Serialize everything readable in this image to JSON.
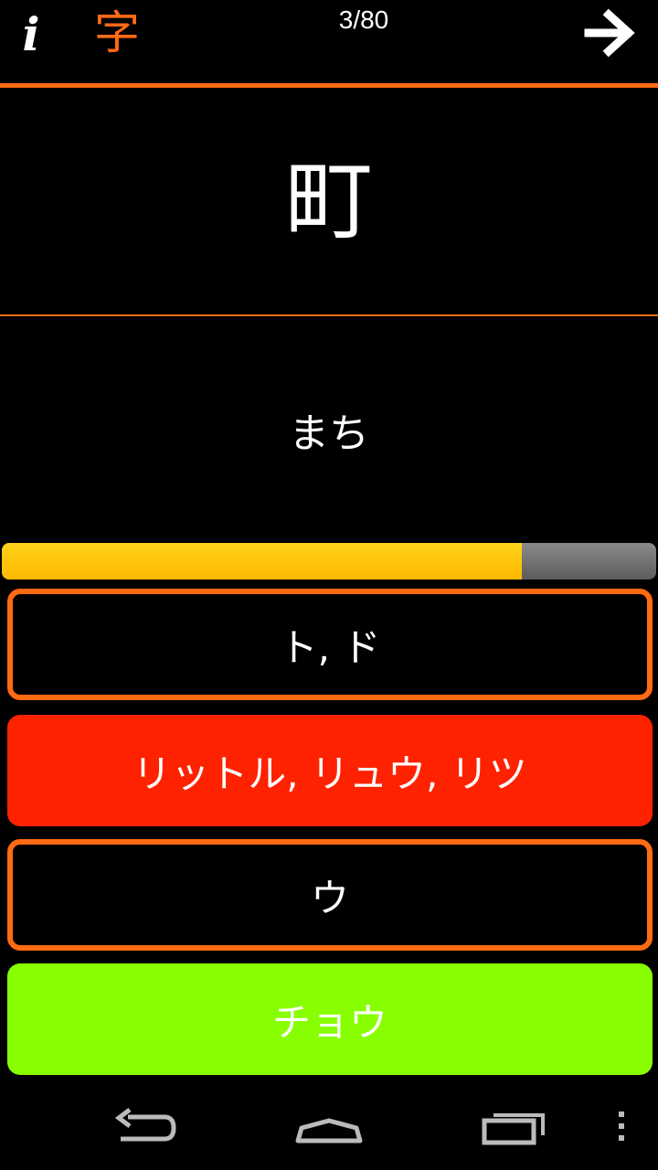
{
  "header": {
    "info_label": "i",
    "kanji_mode_label": "字",
    "counter": "3/80",
    "next_icon": "arrow-right-icon"
  },
  "card": {
    "kanji": "町",
    "reading": "まち"
  },
  "timer": {
    "fraction_remaining": 0.795
  },
  "answers": [
    {
      "label": "ト, ド",
      "state": "neutral"
    },
    {
      "label": "リットル, リュウ, リツ",
      "state": "wrong"
    },
    {
      "label": "ウ",
      "state": "neutral"
    },
    {
      "label": "チョウ",
      "state": "correct"
    }
  ],
  "colors": {
    "accent": "#ff6a13",
    "wrong": "#ff2200",
    "correct": "#88ff00",
    "timer": "#ffc000"
  },
  "navbar": {
    "icons": [
      "back-icon",
      "home-icon",
      "recents-icon",
      "overflow-menu-icon"
    ]
  }
}
